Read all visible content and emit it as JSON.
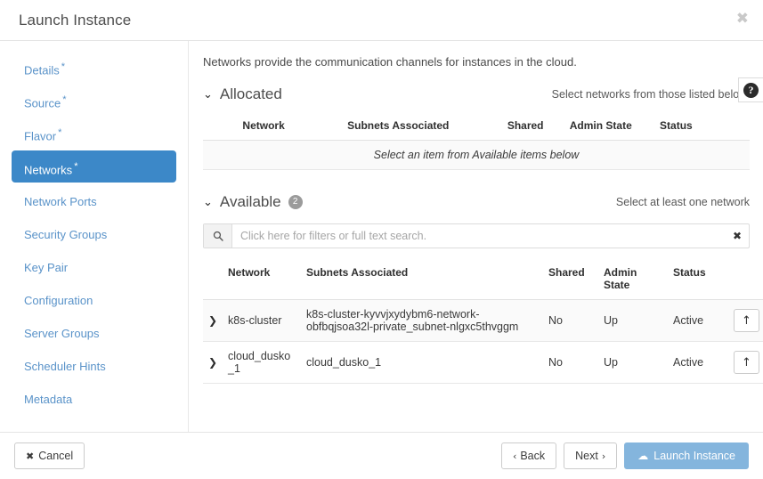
{
  "header": {
    "title": "Launch Instance",
    "close_icon": "close-icon",
    "close_glyph": "✖"
  },
  "help": {
    "icon": "help-icon",
    "glyph": "?"
  },
  "sidebar": {
    "items": [
      {
        "label": "Details",
        "required": "*",
        "active": false
      },
      {
        "label": "Source",
        "required": "*",
        "active": false
      },
      {
        "label": "Flavor",
        "required": "*",
        "active": false
      },
      {
        "label": "Networks",
        "required": "*",
        "active": true
      },
      {
        "label": "Network Ports",
        "required": "",
        "active": false
      },
      {
        "label": "Security Groups",
        "required": "",
        "active": false
      },
      {
        "label": "Key Pair",
        "required": "",
        "active": false
      },
      {
        "label": "Configuration",
        "required": "",
        "active": false
      },
      {
        "label": "Server Groups",
        "required": "",
        "active": false
      },
      {
        "label": "Scheduler Hints",
        "required": "",
        "active": false
      },
      {
        "label": "Metadata",
        "required": "",
        "active": false
      }
    ]
  },
  "main": {
    "intro": "Networks provide the communication channels for instances in the cloud.",
    "allocated": {
      "chevron": "⌄",
      "title": "Allocated",
      "hint": "Select networks from those listed below.",
      "columns": [
        "Network",
        "Subnets Associated",
        "Shared",
        "Admin State",
        "Status"
      ],
      "empty_message": "Select an item from Available items below"
    },
    "available": {
      "chevron": "⌄",
      "title": "Available",
      "count": "2",
      "hint": "Select at least one network",
      "search": {
        "placeholder": "Click here for filters or full text search.",
        "value": "",
        "icon": "search-icon",
        "clear_icon": "clear-icon",
        "clear_glyph": "✖"
      },
      "columns": [
        "Network",
        "Subnets Associated",
        "Shared",
        "Admin State",
        "Status"
      ],
      "rows": [
        {
          "network": "k8s-cluster",
          "subnets": "k8s-cluster-kyvvjxydybm6-network-obfbqjsoa32l-private_subnet-nlgxc5thvggm",
          "shared": "No",
          "admin_state": "Up",
          "status": "Active",
          "action_glyph": "↑"
        },
        {
          "network": "cloud_dusko_1",
          "subnets": "cloud_dusko_1",
          "shared": "No",
          "admin_state": "Up",
          "status": "Active",
          "action_glyph": "↑"
        }
      ]
    }
  },
  "footer": {
    "cancel": "Cancel",
    "cancel_glyph": "✖",
    "back": "Back",
    "back_caret": "‹",
    "next": "Next",
    "next_caret": "›",
    "launch": "Launch Instance",
    "launch_glyph": "☁"
  },
  "colors": {
    "accent": "#3c88c8",
    "link": "#5a93c9",
    "primary_button": "#84b5dd",
    "badge": "#9b9b9b"
  }
}
